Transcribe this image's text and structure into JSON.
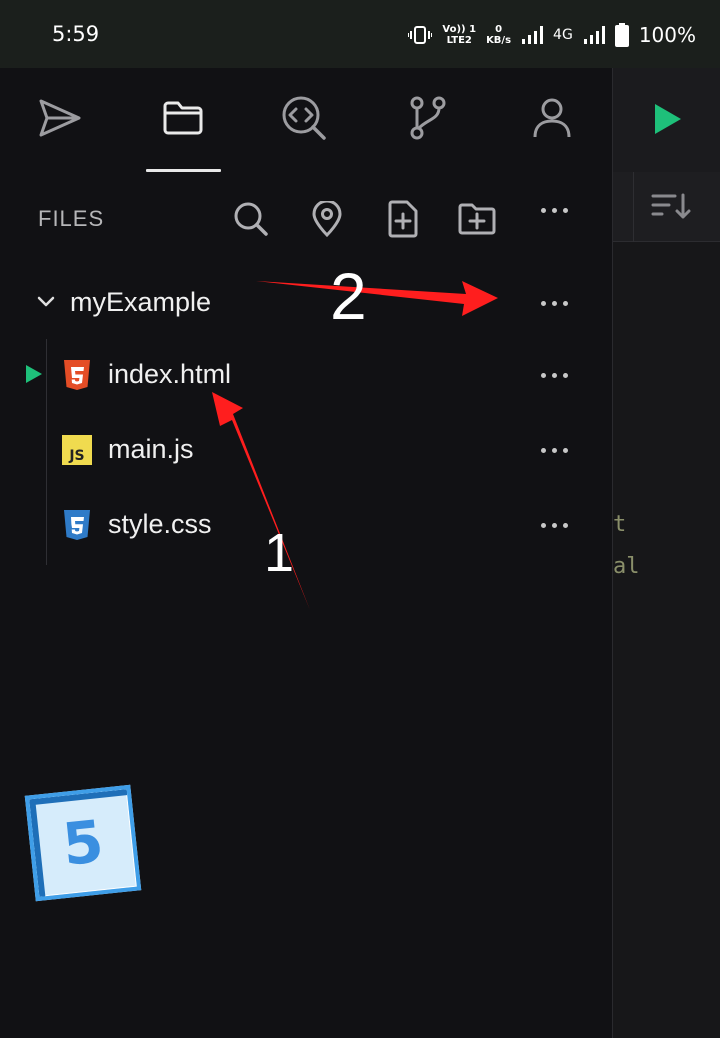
{
  "status_bar": {
    "time": "5:59",
    "volte_top": "Vo)) 1",
    "volte_bottom": "LTE2",
    "speed_top": "0",
    "speed_bottom": "KB/s",
    "network": "4G",
    "battery": "100%"
  },
  "nav": {
    "items": [
      {
        "icon": "send-icon"
      },
      {
        "icon": "folder-icon",
        "active": true
      },
      {
        "icon": "code-search-icon"
      },
      {
        "icon": "git-branch-icon"
      },
      {
        "icon": "user-icon"
      }
    ]
  },
  "files_header": {
    "label": "FILES",
    "actions": [
      "search-icon",
      "location-pin-icon",
      "new-file-icon",
      "new-folder-icon",
      "more-icon"
    ]
  },
  "tree": {
    "folder": {
      "name": "myExample",
      "expanded": true
    },
    "files": [
      {
        "name": "index.html",
        "icon": "html5-icon",
        "running": true
      },
      {
        "name": "main.js",
        "icon": "javascript-icon"
      },
      {
        "name": "style.css",
        "icon": "css3-icon"
      }
    ]
  },
  "editor": {
    "code_fragment_1": "t",
    "code_fragment_2": "al"
  },
  "annotations": {
    "label_1": "1",
    "label_2": "2",
    "badge": "5"
  },
  "colors": {
    "run_green": "#1ec07a",
    "arrow_red": "#ff1e1e",
    "html_orange": "#e44d26",
    "js_yellow": "#f0db4f",
    "css_blue": "#2f7bc8"
  }
}
